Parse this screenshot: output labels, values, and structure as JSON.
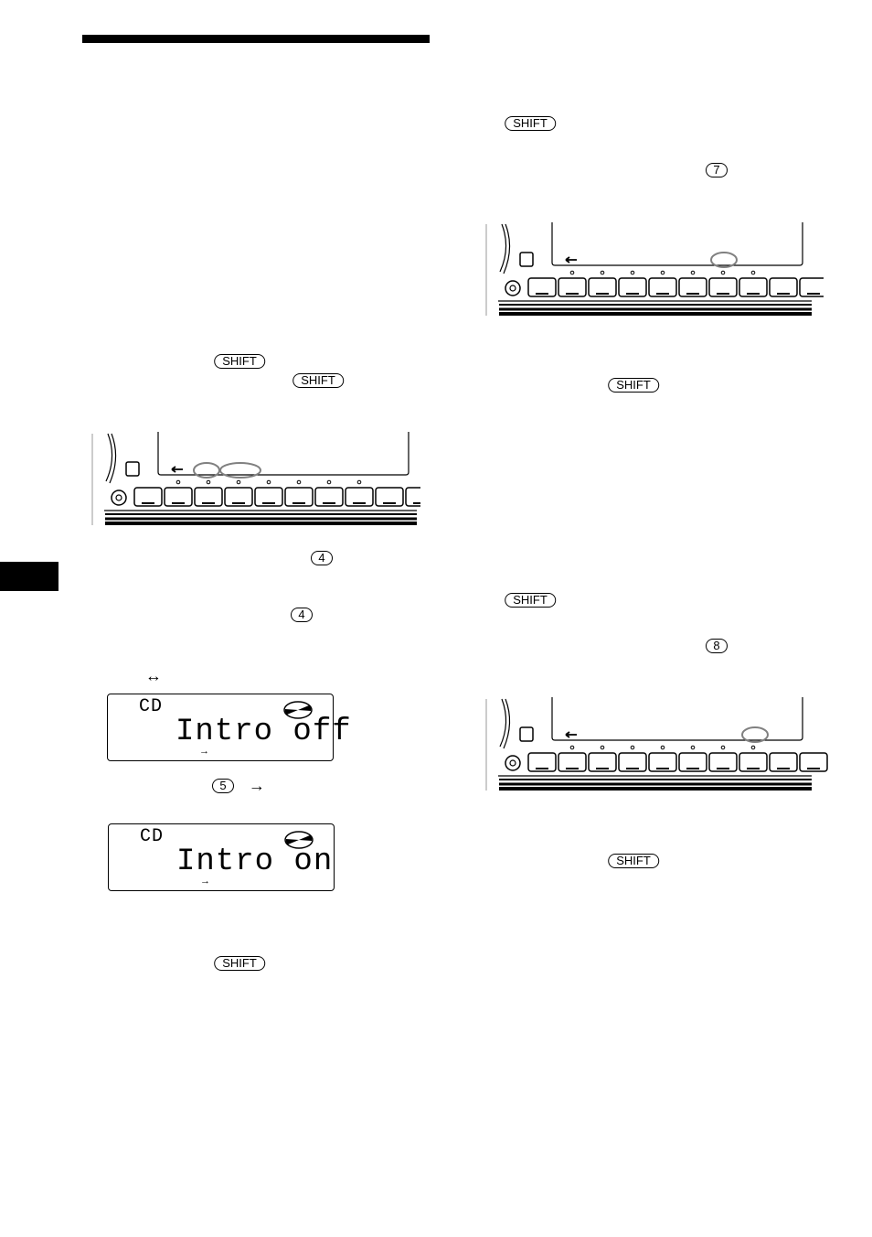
{
  "keys": {
    "shift": "SHIFT"
  },
  "numbers": {
    "n7": "7",
    "n4a": "4",
    "n4b": "4",
    "n8": "8",
    "n5": "5"
  },
  "arrows": {
    "both": "↔",
    "right": "→"
  },
  "lcd_off": {
    "source": "CD",
    "message": "Intro off"
  },
  "lcd_on": {
    "source": "CD",
    "message": "Intro on"
  },
  "colors": {
    "highlight": "#808080",
    "ink": "#000000"
  }
}
